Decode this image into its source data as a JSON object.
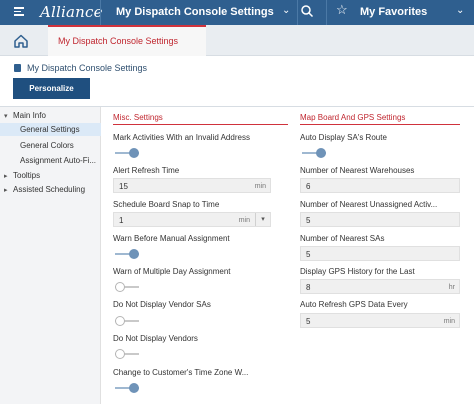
{
  "header": {
    "logo": "Alliance",
    "title": "My Dispatch Console Settings",
    "favorites_label": "My Favorites"
  },
  "tabs": {
    "active_tab": "My Dispatch Console Settings"
  },
  "page": {
    "heading": "My Dispatch Console Settings",
    "personalize_label": "Personalize"
  },
  "sidebar": {
    "items": [
      {
        "label": "Main Info"
      },
      {
        "label": "General Settings"
      },
      {
        "label": "General Colors"
      },
      {
        "label": "Assignment Auto-Fi..."
      },
      {
        "label": "Tooltips"
      },
      {
        "label": "Assisted Scheduling"
      }
    ]
  },
  "misc": {
    "title": "Misc. Settings",
    "mark_invalid_label": "Mark Activities With an Invalid Address",
    "mark_invalid_on": true,
    "alert_refresh_label": "Alert Refresh Time",
    "alert_refresh_value": "15",
    "alert_refresh_unit": "min",
    "snap_label": "Schedule Board Snap to Time",
    "snap_value": "1",
    "snap_unit": "min",
    "warn_manual_label": "Warn Before Manual Assignment",
    "warn_manual_on": true,
    "warn_multi_label": "Warn of Multiple Day Assignment",
    "warn_multi_on": false,
    "no_vendor_sas_label": "Do Not Display Vendor SAs",
    "no_vendor_sas_on": false,
    "no_vendors_label": "Do Not Display Vendors",
    "no_vendors_on": false,
    "tz_label": "Change to Customer's Time Zone W...",
    "tz_on": true
  },
  "map": {
    "title": "Map Board And GPS Settings",
    "auto_display_label": "Auto Display SA's Route",
    "auto_display_on": true,
    "warehouses_label": "Number of Nearest Warehouses",
    "warehouses_value": "6",
    "unassigned_label": "Number of Nearest Unassigned Activ...",
    "unassigned_value": "5",
    "nearest_sas_label": "Number of Nearest SAs",
    "nearest_sas_value": "5",
    "gps_history_label": "Display GPS History for the Last",
    "gps_history_value": "8",
    "gps_history_unit": "hr",
    "gps_refresh_label": "Auto Refresh GPS Data Every",
    "gps_refresh_value": "5",
    "gps_refresh_unit": "min"
  },
  "colors": {
    "header_bg": "#2f5f8f",
    "accent_red": "#c0262f",
    "button_blue": "#1f4f7f"
  },
  "icons": [
    "menu-icon",
    "chevron-down-icon",
    "search-icon",
    "star-icon",
    "home-icon",
    "document-icon",
    "caret-down-icon",
    "caret-right-icon"
  ]
}
